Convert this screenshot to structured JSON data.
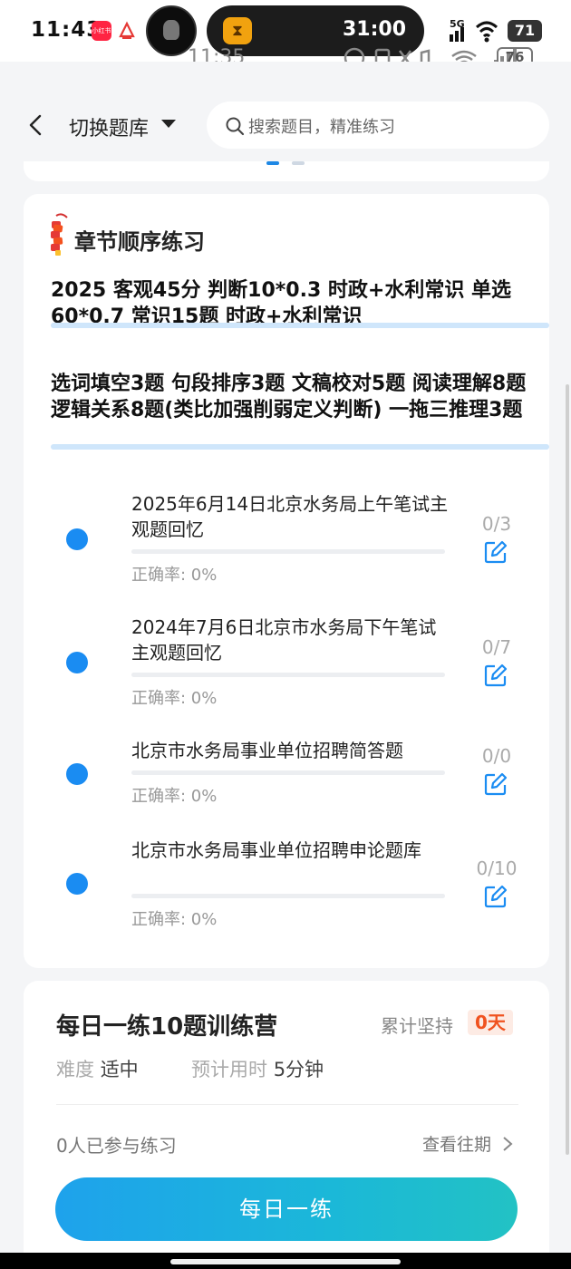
{
  "status_bar": {
    "time": "11:43",
    "xhs_label": "小红书",
    "timer": "31:00",
    "ghost_time": "11:35",
    "ghost_battery": "76",
    "network": "5G",
    "battery": "71"
  },
  "header": {
    "switch_label": "切换题库",
    "search_placeholder": "搜索题目，精准练习"
  },
  "chapter": {
    "title": "章节顺序练习",
    "note1": "2025 客观45分 判断10*0.3 时政+水利常识 单选60*0.7 常识15题 时政+水利常识",
    "note2": "选词填空3题 句段排序3题 文稿校对5题 阅读理解8题 逻辑关系8题(类比加强削弱定义判断) 一拖三推理3题",
    "items": [
      {
        "title": "2025年6月14日北京水务局上午笔试主观题回忆",
        "accuracy": "正确率:  0%",
        "count": "0/3"
      },
      {
        "title": "2024年7月6日北京市水务局下午笔试主观题回忆",
        "accuracy": "正确率:  0%",
        "count": "0/7"
      },
      {
        "title": "北京市水务局事业单位招聘简答题",
        "accuracy": "正确率:  0%",
        "count": "0/0"
      },
      {
        "title": "北京市水务局事业单位招聘申论题库",
        "accuracy": "正确率:  0%",
        "count": "0/10"
      }
    ]
  },
  "daily": {
    "title": "每日一练10题训练营",
    "persist_label": "累计坚持",
    "persist_value": "0天",
    "difficulty_label": "难度",
    "difficulty_value": "适中",
    "time_label": "预计用时",
    "time_value": "5分钟",
    "participants": "0人已参与练习",
    "history_link": "查看往期",
    "button_label": "每日一练"
  },
  "colors": {
    "accent": "#1a8cf2",
    "badge_text": "#f0521f",
    "button_start": "#1ea2ec",
    "button_end": "#22c2c4"
  }
}
